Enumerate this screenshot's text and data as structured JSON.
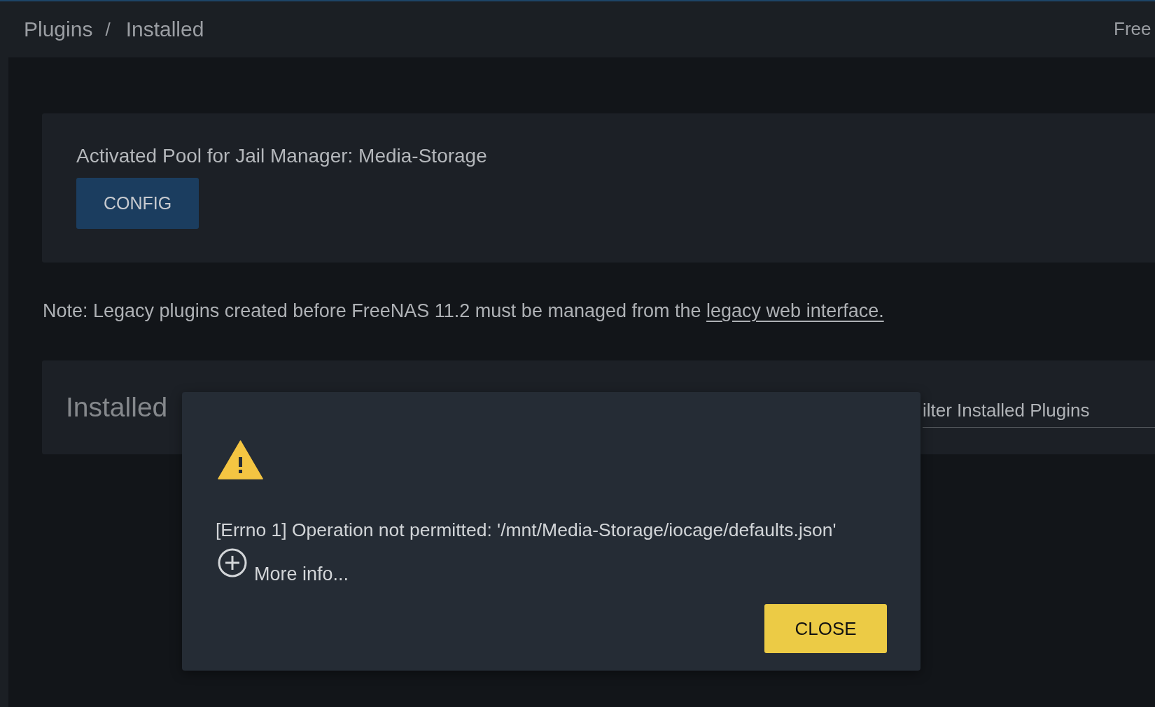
{
  "topbar": {
    "breadcrumb": [
      "Plugins",
      "Installed"
    ],
    "separator": "/",
    "right_text": "Free"
  },
  "pool_card": {
    "label": "Activated Pool for Jail Manager: Media-Storage",
    "button": "CONFIG"
  },
  "note": {
    "text": "Note: Legacy plugins created before FreeNAS 11.2 must be managed from the ",
    "link": "legacy web interface."
  },
  "installed_panel": {
    "title": "Installed",
    "filter": {
      "placeholder": "ilter Installed Plugins"
    }
  },
  "dialog": {
    "message": "[Errno 1] Operation not permitted: '/mnt/Media-Storage/iocage/defaults.json'",
    "more_info": "More info...",
    "button": "CLOSE"
  }
}
